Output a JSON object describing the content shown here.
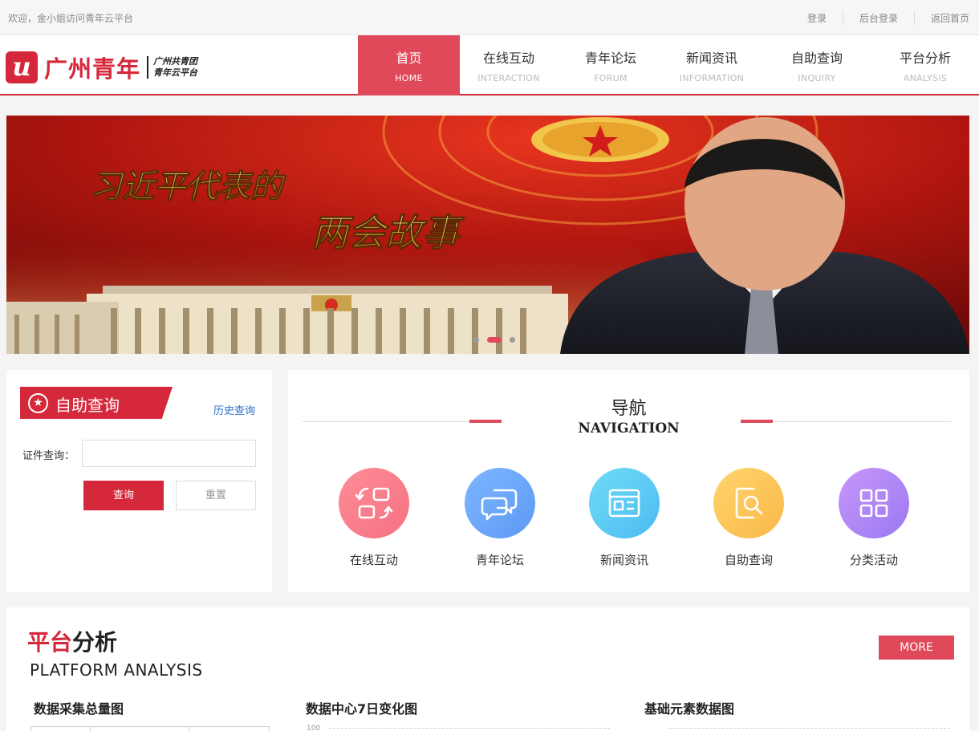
{
  "topbar": {
    "welcome": "欢迎，金小姐访问青年云平台",
    "links": [
      "登录",
      "后台登录",
      "返回首页"
    ]
  },
  "brand": {
    "logo_mark": "u",
    "name": "广州青年",
    "sub_line1": "广州共青团",
    "sub_line2": "青年云平台",
    "color": "#d6283b"
  },
  "nav": {
    "items": [
      {
        "zh": "首页",
        "en": "HOME",
        "active": true
      },
      {
        "zh": "在线互动",
        "en": "INTERACTION"
      },
      {
        "zh": "青年论坛",
        "en": "FORUM"
      },
      {
        "zh": "新闻资讯",
        "en": "INFORMATION"
      },
      {
        "zh": "自助查询",
        "en": "INQUIRY"
      },
      {
        "zh": "平台分析",
        "en": "ANALYSIS"
      }
    ]
  },
  "banner": {
    "headline_line1": "习近平代表的",
    "headline_line2": "两会故事",
    "slide_count": 3,
    "active_slide": 2
  },
  "query": {
    "title": "自助查询",
    "history_link": "历史查询",
    "id_label": "证件查询：",
    "id_placeholder": "",
    "search_label": "查询",
    "reset_label": "重置"
  },
  "navigation": {
    "title": "导航",
    "subtitle": "NAVIGATION",
    "items": [
      {
        "label": "在线互动",
        "icon": "swap-arrows-icon",
        "color_from": "#fc8d96",
        "color_to": "#f77183"
      },
      {
        "label": "青年论坛",
        "icon": "chat-bubbles-icon",
        "color_from": "#7db6ff",
        "color_to": "#5d99f5"
      },
      {
        "label": "新闻资讯",
        "icon": "news-document-icon",
        "color_from": "#6fdcf7",
        "color_to": "#4cbbf0"
      },
      {
        "label": "自助查询",
        "icon": "document-search-icon",
        "color_from": "#fed46c",
        "color_to": "#fbb84a"
      },
      {
        "label": "分类活动",
        "icon": "grid-category-icon",
        "color_from": "#c796fa",
        "color_to": "#9a79f1"
      }
    ]
  },
  "analysis": {
    "title_red": "平台",
    "title_dark": "分析",
    "subtitle": "PLATFORM ANALYSIS",
    "more_label": "MORE",
    "charts": [
      "数据采集总量图",
      "数据中心7日变化图",
      "基础元素数据图"
    ],
    "partial_tick": "100"
  }
}
